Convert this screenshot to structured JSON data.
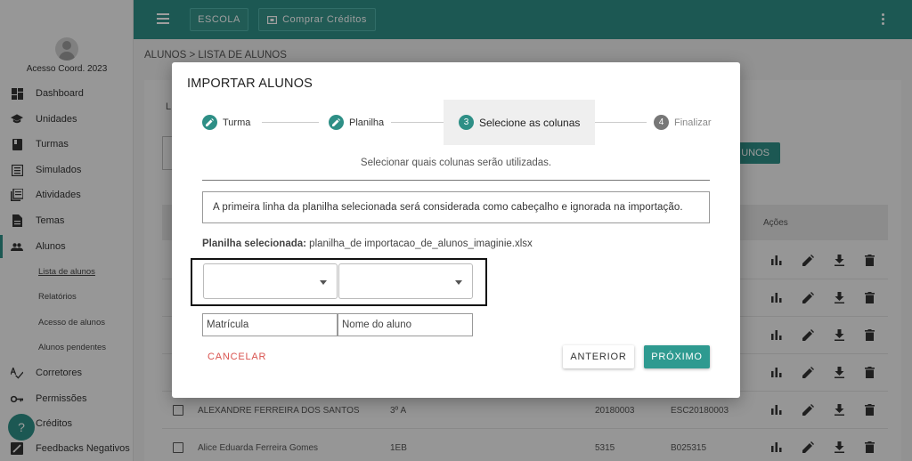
{
  "topbar": {
    "school_label": "ESCOLA",
    "buy_credits_label": "Comprar Créditos"
  },
  "user": {
    "name": "Acesso Coord. 2023"
  },
  "sidebar": {
    "items": [
      {
        "label": "Dashboard",
        "icon": "dashboard-icon"
      },
      {
        "label": "Unidades",
        "icon": "graduation-cap-icon"
      },
      {
        "label": "Turmas",
        "icon": "book-icon"
      },
      {
        "label": "Simulados",
        "icon": "list-alt-icon"
      },
      {
        "label": "Atividades",
        "icon": "library-books-icon"
      },
      {
        "label": "Temas",
        "icon": "document-icon"
      },
      {
        "label": "Alunos",
        "icon": "people-icon"
      },
      {
        "label": "Corretores",
        "icon": "spellcheck-icon"
      },
      {
        "label": "Permissões",
        "icon": "key-icon"
      },
      {
        "label": "Créditos",
        "icon": "credits-icon"
      },
      {
        "label": "Feedbacks Negativos",
        "icon": "feedback-icon"
      }
    ],
    "subitems": [
      {
        "label": "Lista de alunos"
      },
      {
        "label": "Relatórios"
      },
      {
        "label": "Acesso de alunos"
      },
      {
        "label": "Alunos pendentes"
      }
    ]
  },
  "breadcrumb": "ALUNOS > LISTA DE ALUNOS",
  "background": {
    "card_label_fragment": "L",
    "add_button_fragment": "UNOS",
    "actions_header": "Ações",
    "rows": [
      {
        "name": "ALEXANDRE FERREIRA DOS SANTOS",
        "class": "3º A",
        "registration": "20180003",
        "code": "ESC20180003"
      },
      {
        "name": "Alice Eduarda Ferreira Gomes",
        "class": "1EB",
        "registration": "5315",
        "code": "B025315"
      }
    ]
  },
  "modal": {
    "title": "IMPORTAR ALUNOS",
    "steps": [
      {
        "label": "Turma",
        "state": "done"
      },
      {
        "label": "Planilha",
        "state": "done"
      },
      {
        "number": "3",
        "label": "Selecione as colunas",
        "state": "active"
      },
      {
        "number": "4",
        "label": "Finalizar",
        "state": "pending"
      }
    ],
    "instruction": "Selecionar quais colunas serão utilizadas.",
    "notice": "A primeira linha da planilha selecionada será considerada como cabeçalho e ignorada na importação.",
    "sheet_label": "Planilha selecionada:",
    "sheet_name": "planilha_de importacao_de_alunos_imaginie.xlsx",
    "column_labels": [
      "Matrícula",
      "Nome do aluno"
    ],
    "cancel_label": "CANCELAR",
    "previous_label": "ANTERIOR",
    "next_label": "PRÓXIMO"
  },
  "colors": {
    "primary": "#2e8f86",
    "danger": "#d9534f"
  }
}
